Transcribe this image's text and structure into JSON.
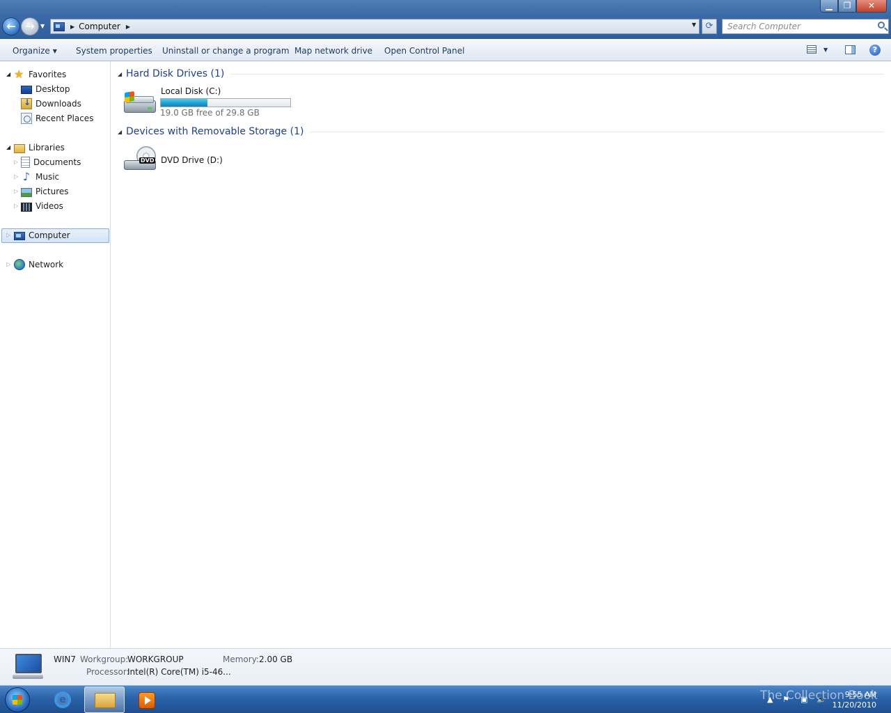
{
  "window": {
    "controls": {
      "minimize": "▁",
      "maximize": "❐",
      "close": "✕"
    }
  },
  "address_bar": {
    "crumbs": [
      "Computer"
    ],
    "search_placeholder": "Search Computer"
  },
  "command_bar": {
    "items": [
      "Organize",
      "System properties",
      "Uninstall or change a program",
      "Map network drive",
      "Open Control Panel"
    ],
    "icons": [
      "views-icon",
      "preview-pane-icon",
      "help-icon"
    ]
  },
  "nav_pane": {
    "favorites": {
      "label": "Favorites",
      "items": [
        "Desktop",
        "Downloads",
        "Recent Places"
      ]
    },
    "libraries": {
      "label": "Libraries",
      "items": [
        "Documents",
        "Music",
        "Pictures",
        "Videos"
      ]
    },
    "computer": {
      "label": "Computer",
      "selected": true
    },
    "network": {
      "label": "Network"
    }
  },
  "content": {
    "groups": [
      {
        "title": "Hard Disk Drives (1)",
        "drives": [
          {
            "name": "Local Disk (C:)",
            "free_text": "19.0 GB free of 29.8 GB",
            "used_fraction": 0.36,
            "icon": "hard-disk-icon"
          }
        ]
      },
      {
        "title": "Devices with Removable Storage (1)",
        "drives": [
          {
            "name": "DVD Drive (D:)",
            "icon": "dvd-drive-icon",
            "badge": "DVD"
          }
        ]
      }
    ]
  },
  "details_pane": {
    "computer_name": "WIN7",
    "workgroup_label": "Workgroup:",
    "workgroup_value": "WORKGROUP",
    "memory_label": "Memory:",
    "memory_value": "2.00 GB",
    "processor_label": "Processor:",
    "processor_value": "Intel(R) Core(TM) i5-46..."
  },
  "taskbar": {
    "pinned": [
      "internet-explorer-icon",
      "windows-explorer-icon",
      "media-player-icon"
    ],
    "watermark": "The Collection Book",
    "clock_time": "9:55 AM",
    "clock_date": "11/20/2010",
    "colors": {
      "accent": "#1e3f8c",
      "bar_fill": "#26a5d6"
    }
  }
}
